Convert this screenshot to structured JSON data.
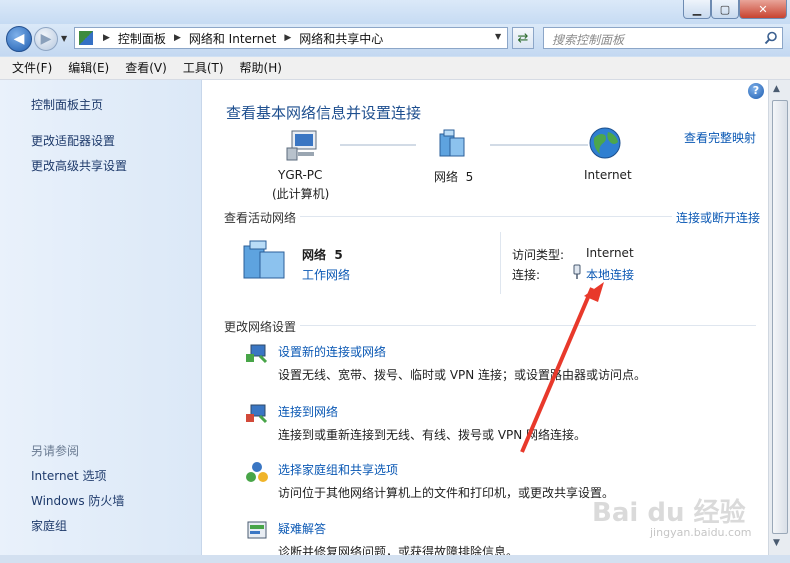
{
  "nav": {
    "breadcrumbs": [
      "控制面板",
      "网络和 Internet",
      "网络和共享中心"
    ],
    "search_placeholder": "搜索控制面板"
  },
  "menu": [
    "文件(F)",
    "编辑(E)",
    "查看(V)",
    "工具(T)",
    "帮助(H)"
  ],
  "sidebar": {
    "links": [
      "控制面板主页",
      "更改适配器设置",
      "更改高级共享设置"
    ],
    "see_also_label": "另请参阅",
    "see_also": [
      "Internet 选项",
      "Windows 防火墙",
      "家庭组"
    ]
  },
  "main": {
    "title": "查看基本网络信息并设置连接",
    "view_full_map": "查看完整映射",
    "map": {
      "computer_name": "YGR-PC",
      "computer_sub": "(此计算机)",
      "network": "网络  5",
      "internet": "Internet"
    },
    "active_label": "查看活动网络",
    "connect_disconnect": "连接或断开连接",
    "active": {
      "name": "网络  5",
      "type": "工作网络",
      "access_label": "访问类型:",
      "access_value": "Internet",
      "conn_label": "连接:",
      "conn_value": "本地连接"
    },
    "change_label": "更改网络设置",
    "tasks": [
      {
        "title": "设置新的连接或网络",
        "desc": "设置无线、宽带、拨号、临时或 VPN 连接；或设置路由器或访问点。"
      },
      {
        "title": "连接到网络",
        "desc": "连接到或重新连接到无线、有线、拨号或 VPN 网络连接。"
      },
      {
        "title": "选择家庭组和共享选项",
        "desc": "访问位于其他网络计算机上的文件和打印机，或更改共享设置。"
      },
      {
        "title": "疑难解答",
        "desc": "诊断并修复网络问题，或获得故障排除信息。"
      }
    ]
  },
  "watermark": {
    "brand": "Bai du 经验",
    "url": "jingyan.baidu.com"
  },
  "colors": {
    "link": "#0a58b4",
    "title": "#1e4f8f",
    "annotation_arrow": "#e8392b"
  }
}
